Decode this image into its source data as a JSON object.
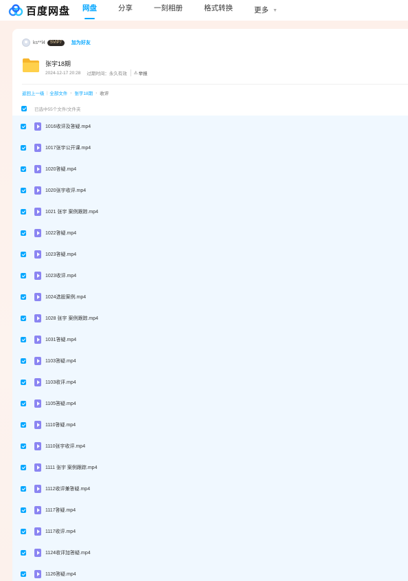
{
  "nav": {
    "logo_text": "百度网盘",
    "items": [
      "网盘",
      "分享",
      "一刻相册",
      "格式转换",
      "更多"
    ],
    "active_index": 0
  },
  "sharer": {
    "name": "ks**l4",
    "badge": "SVIP7",
    "add_friend": "加为好友"
  },
  "folder": {
    "title": "张宇18期",
    "date": "2024-12-17 20:28",
    "expiry": "过期时间：永久有效",
    "report": "举报"
  },
  "breadcrumb": {
    "back": "返回上一级",
    "all_files": "全部文件",
    "parent": "张宇18期",
    "current": "收评"
  },
  "select_all_label": "已选中55个文件/文件夹",
  "colors": {
    "accent": "#06a7ff",
    "row_bg": "#f0f8ff",
    "video_icon": "#8b85f2"
  },
  "files": [
    "1016收评及答疑.mp4",
    "1017张宇公开课.mp4",
    "1020答疑.mp4",
    "1020张宇收评.mp4",
    "1021 张宇 案例跟踪.mp4",
    "1022答疑.mp4",
    "1023答疑.mp4",
    "1023收评.mp4",
    "1024选股案例.mp4",
    "1028 张宇 案例跟踪.mp4",
    "1031答疑.mp4",
    "1103答疑.mp4",
    "1103收评.mp4",
    "1105答疑.mp4",
    "1110答疑.mp4",
    "1110张宇收评.mp4",
    "1111 张宇 案例跟踪.mp4",
    "1112收评兼答疑.mp4",
    "1117答疑.mp4",
    "1117收评.mp4",
    "1124收评加答疑.mp4",
    "1126答疑.mp4"
  ]
}
